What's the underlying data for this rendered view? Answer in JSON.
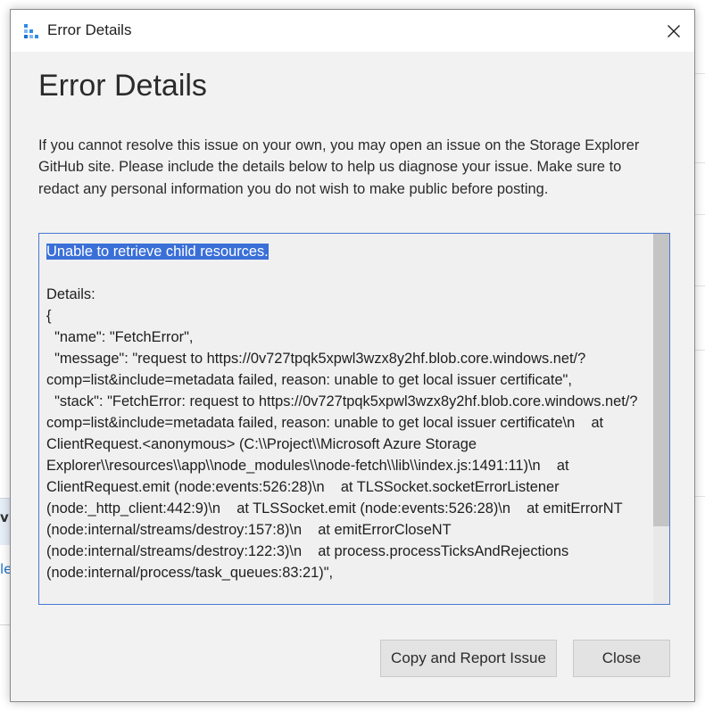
{
  "background": {
    "fragment_1": "vi",
    "fragment_2": "le"
  },
  "window": {
    "title": "Error Details",
    "app_icon": "storage-explorer-icon",
    "close_icon": "close-icon"
  },
  "dialog": {
    "heading": "Error Details",
    "description": "If you cannot resolve this issue on your own, you may open an issue on the Storage Explorer GitHub site. Please include the details below to help us diagnose your issue. Make sure to redact any personal information you do not wish to make public before posting.",
    "details_selected": "Unable to retrieve child resources.",
    "details_rest": "\n\nDetails:\n{\n  \"name\": \"FetchError\",\n  \"message\": \"request to https://0v727tpqk5xpwl3wzx8y2hf.blob.core.windows.net/?comp=list&include=metadata failed, reason: unable to get local issuer certificate\",\n  \"stack\": \"FetchError: request to https://0v727tpqk5xpwl3wzx8y2hf.blob.core.windows.net/?comp=list&include=metadata failed, reason: unable to get local issuer certificate\\n    at ClientRequest.<anonymous> (C:\\\\Project\\\\Microsoft Azure Storage Explorer\\\\resources\\\\app\\\\node_modules\\\\node-fetch\\\\lib\\\\index.js:1491:11)\\n    at ClientRequest.emit (node:events:526:28)\\n    at TLSSocket.socketErrorListener (node:_http_client:442:9)\\n    at TLSSocket.emit (node:events:526:28)\\n    at emitErrorNT (node:internal/streams/destroy:157:8)\\n    at emitErrorCloseNT (node:internal/streams/destroy:122:3)\\n    at process.processTicksAndRejections (node:internal/process/task_queues:83:21)\",",
    "copy_button": "Copy and Report Issue",
    "close_button": "Close"
  },
  "colors": {
    "selection": "#3a6fd8",
    "details_border": "#4a78d0",
    "button_bg": "#e3e3e3"
  }
}
